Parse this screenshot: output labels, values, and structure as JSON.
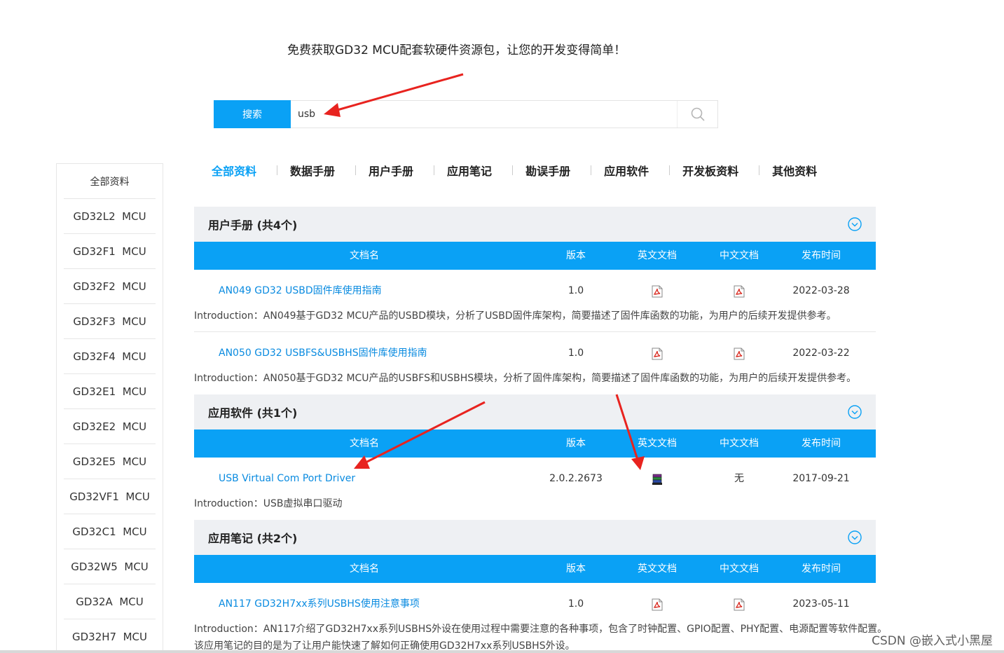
{
  "headline": "免费获取GD32 MCU配套软硬件资源包，让您的开发变得简单！",
  "search": {
    "button_label": "搜索",
    "value": "usb"
  },
  "sidebar": {
    "items": [
      "全部资料",
      "GD32L2  MCU",
      "GD32F1  MCU",
      "GD32F2  MCU",
      "GD32F3  MCU",
      "GD32F4  MCU",
      "GD32E1  MCU",
      "GD32E2  MCU",
      "GD32E5  MCU",
      "GD32VF1  MCU",
      "GD32C1  MCU",
      "GD32W5  MCU",
      "GD32A  MCU",
      "GD32H7  MCU"
    ]
  },
  "tabs": [
    "全部资料",
    "数据手册",
    "用户手册",
    "应用笔记",
    "勘误手册",
    "应用软件",
    "开发板资料",
    "其他资料"
  ],
  "table_headers": {
    "name": "文档名",
    "version": "版本",
    "en_doc": "英文文档",
    "cn_doc": "中文文档",
    "date": "发布时间"
  },
  "sections": [
    {
      "title": "用户手册 (共4个)",
      "rows": [
        {
          "name": "AN049 GD32 USBD固件库使用指南",
          "version": "1.0",
          "date": "2022-03-28",
          "intro": "Introduction：AN049基于GD32 MCU产品的USBD模块，分析了USBD固件库架构，简要描述了固件库函数的功能，为用户的后续开发提供参考。"
        },
        {
          "name": "AN050 GD32 USBFS&USBHS固件库使用指南",
          "version": "1.0",
          "date": "2022-03-22",
          "intro": "Introduction：AN050基于GD32 MCU产品的USBFS和USBHS模块，分析了固件库架构，简要描述了固件库函数的功能，为用户的后续开发提供参考。"
        }
      ]
    },
    {
      "title": "应用软件 (共1个)",
      "rows": [
        {
          "name": "USB Virtual Com Port Driver",
          "version": "2.0.2.2673",
          "cn_doc": "无",
          "date": "2017-09-21",
          "intro": "Introduction：USB虚拟串口驱动"
        }
      ]
    },
    {
      "title": "应用笔记 (共2个)",
      "rows": [
        {
          "name": "AN117 GD32H7xx系列USBHS使用注意事项",
          "version": "1.0",
          "date": "2023-05-11",
          "intro": "Introduction：AN117介绍了GD32H7xx系列USBHS外设在使用过程中需要注意的各种事项，包含了时钟配置、GPIO配置、PHY配置、电源配置等软件配置。",
          "intro2": "该应用笔记的目的是为了让用户能快速了解如何正确使用GD32H7xx系列USBHS外设。"
        }
      ]
    }
  ],
  "watermark": "CSDN @嵌入式小黑屋",
  "colors": {
    "accent": "#0aa1f5",
    "link": "#0a8be0",
    "annotation_arrow": "#e8231f"
  }
}
